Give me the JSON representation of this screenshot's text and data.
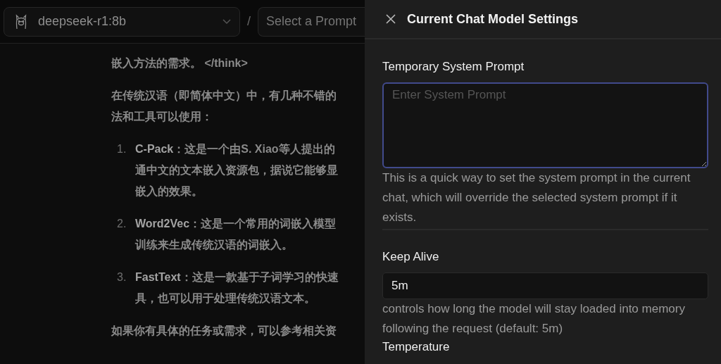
{
  "header": {
    "model_selector": {
      "value": "deepseek-r1:8b"
    },
    "separator": "/",
    "prompt_selector": {
      "placeholder": "Select a Prompt"
    }
  },
  "chat": {
    "blocks": [
      {
        "kind": "paragraph",
        "lines": [
          "嵌入方法的需求。 </think>"
        ]
      },
      {
        "kind": "paragraph",
        "lines": [
          "在传统汉语（即简体中文）中，有几种不错的",
          "法和工具可以使用："
        ]
      },
      {
        "kind": "list_item",
        "number": "1.",
        "lines": [
          "**C-Pack**：这是一个由S. Xiao等人提出的",
          "通中文的文本嵌入资源包，据说它能够显",
          "嵌入的效果。"
        ]
      },
      {
        "kind": "list_item",
        "number": "2.",
        "lines": [
          "**Word2Vec**：这是一个常用的词嵌入模型",
          "训练来生成传统汉语的词嵌入。"
        ]
      },
      {
        "kind": "list_item",
        "number": "3.",
        "lines": [
          "**FastText**：这是一款基于子词学习的快速",
          "具，也可以用于处理传统汉语文本。"
        ]
      },
      {
        "kind": "paragraph",
        "lines": [
          "如果你有具体的任务或需求，可以参考相关资"
        ]
      }
    ]
  },
  "settings_panel": {
    "title": "Current Chat Model Settings",
    "fields": [
      {
        "kind": "textarea",
        "label": "Temporary System Prompt",
        "placeholder": "Enter System Prompt",
        "focused": true,
        "help": "This is a quick way to set the system prompt in the current chat, which will override the selected system prompt if it exists."
      },
      {
        "kind": "text",
        "label": "Keep Alive",
        "value": "5m",
        "help": "controls how long the model will stay loaded into memory following the request (default: 5m)"
      },
      {
        "kind": "heading",
        "label": "Temperature"
      }
    ]
  }
}
